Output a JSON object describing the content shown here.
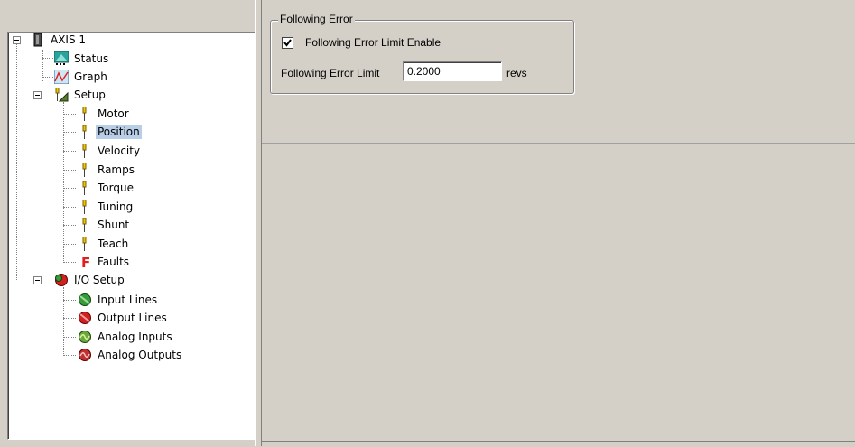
{
  "tree": {
    "root": {
      "label": "AXIS 1",
      "icon": "drive-icon"
    },
    "items": [
      {
        "label": "Status",
        "icon": "status-icon"
      },
      {
        "label": "Graph",
        "icon": "graph-icon"
      },
      {
        "label": "Setup",
        "icon": "setup-icon",
        "children": [
          {
            "label": "Motor",
            "icon": "pin-icon"
          },
          {
            "label": "Position",
            "icon": "pin-icon",
            "selected": true
          },
          {
            "label": "Velocity",
            "icon": "pin-icon"
          },
          {
            "label": "Ramps",
            "icon": "pin-icon"
          },
          {
            "label": "Torque",
            "icon": "pin-icon"
          },
          {
            "label": "Tuning",
            "icon": "pin-icon"
          },
          {
            "label": "Shunt",
            "icon": "pin-icon"
          },
          {
            "label": "Teach",
            "icon": "pin-icon"
          },
          {
            "label": "Faults",
            "icon": "faults-icon"
          }
        ]
      },
      {
        "label": "I/O Setup",
        "icon": "io-icon",
        "children": [
          {
            "label": "Input Lines",
            "icon": "input-lines-icon"
          },
          {
            "label": "Output Lines",
            "icon": "output-lines-icon"
          },
          {
            "label": "Analog Inputs",
            "icon": "analog-inputs-icon"
          },
          {
            "label": "Analog Outputs",
            "icon": "analog-outputs-icon"
          }
        ]
      }
    ]
  },
  "following_error": {
    "group_title": "Following Error",
    "enable_label": "Following Error Limit Enable",
    "enable_checked": true,
    "limit_label": "Following Error Limit",
    "limit_value": "0.2000",
    "limit_unit": "revs"
  },
  "colors": {
    "background": "#d4d0c8",
    "selection": "#b8cde6"
  }
}
